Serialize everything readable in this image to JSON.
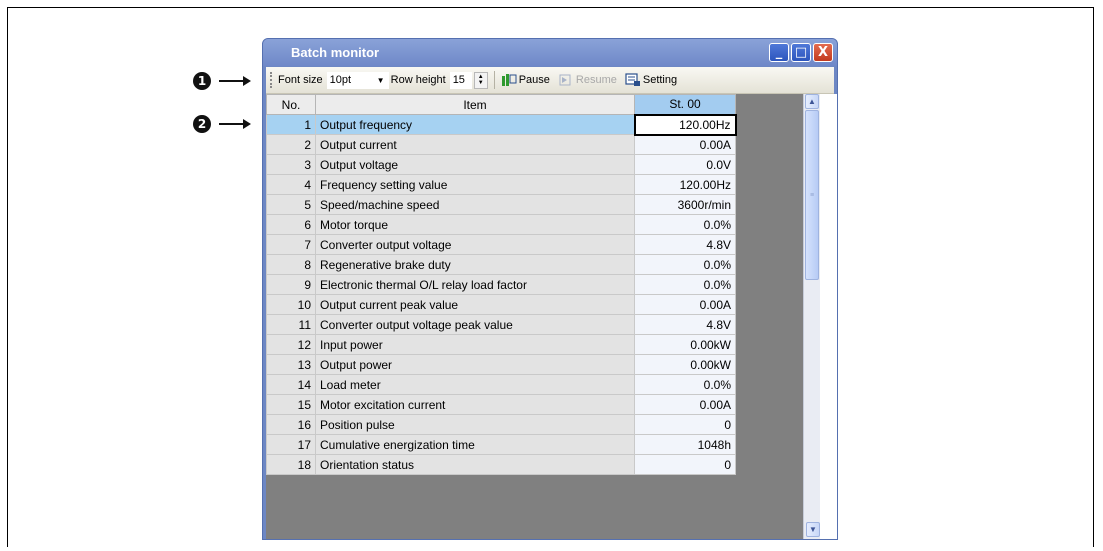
{
  "callouts": [
    "1",
    "2"
  ],
  "window": {
    "title": "Batch monitor",
    "minimize": "_",
    "maximize": "□",
    "close": "X"
  },
  "toolbar": {
    "font_size_label": "Font size",
    "font_size_value": "10pt",
    "row_height_label": "Row height",
    "row_height_value": "15",
    "pause_label": "Pause",
    "resume_label": "Resume",
    "setting_label": "Setting"
  },
  "table": {
    "headers": {
      "no": "No.",
      "item": "Item",
      "station": "St. 00"
    },
    "rows": [
      {
        "no": "1",
        "item": "Output frequency",
        "value": "120.00Hz"
      },
      {
        "no": "2",
        "item": "Output current",
        "value": "0.00A"
      },
      {
        "no": "3",
        "item": "Output voltage",
        "value": "0.0V"
      },
      {
        "no": "4",
        "item": "Frequency setting value",
        "value": "120.00Hz"
      },
      {
        "no": "5",
        "item": "Speed/machine speed",
        "value": "3600r/min"
      },
      {
        "no": "6",
        "item": "Motor torque",
        "value": "0.0%"
      },
      {
        "no": "7",
        "item": "Converter output voltage",
        "value": "4.8V"
      },
      {
        "no": "8",
        "item": "Regenerative brake duty",
        "value": "0.0%"
      },
      {
        "no": "9",
        "item": "Electronic thermal O/L relay load factor",
        "value": "0.0%"
      },
      {
        "no": "10",
        "item": "Output current peak value",
        "value": "0.00A"
      },
      {
        "no": "11",
        "item": "Converter output voltage peak value",
        "value": "4.8V"
      },
      {
        "no": "12",
        "item": "Input power",
        "value": "0.00kW"
      },
      {
        "no": "13",
        "item": "Output power",
        "value": "0.00kW"
      },
      {
        "no": "14",
        "item": "Load meter",
        "value": "0.0%"
      },
      {
        "no": "15",
        "item": "Motor excitation current",
        "value": "0.00A"
      },
      {
        "no": "16",
        "item": "Position pulse",
        "value": "0"
      },
      {
        "no": "17",
        "item": "Cumulative energization time",
        "value": "1048h"
      },
      {
        "no": "18",
        "item": "Orientation status",
        "value": "0"
      }
    ]
  },
  "colors": {
    "title_bar": "#7b93cf",
    "selected_row": "#a6d2f2",
    "header_station": "#a3ccf0",
    "grid_background": "#808080"
  }
}
